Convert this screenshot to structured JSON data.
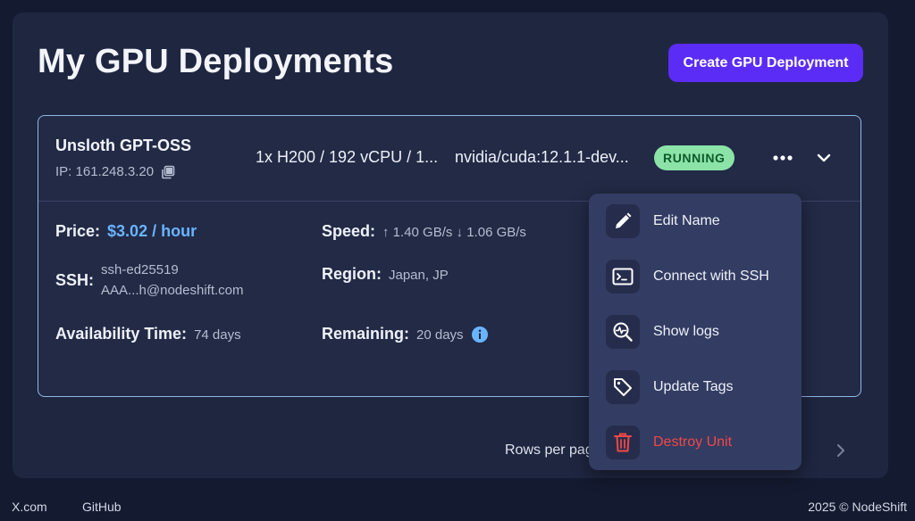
{
  "header": {
    "title": "My GPU Deployments",
    "create_button": "Create GPU Deployment"
  },
  "deployment": {
    "name": "Unsloth GPT-OSS",
    "ip": "IP: 161.248.3.20",
    "spec": "1x H200 / 192 vCPU / 1...",
    "image": "nvidia/cuda:12.1.1-dev...",
    "status": "RUNNING",
    "fields": {
      "price_label": "Price:",
      "price_value": "$3.02 / hour",
      "speed_label": "Speed:",
      "speed_value": "↑ 1.40 GB/s ↓ 1.06 GB/s",
      "ssh_label": "SSH:",
      "ssh_line1": "ssh-ed25519",
      "ssh_line2": "AAA...h@nodeshift.com",
      "region_label": "Region:",
      "region_value": "Japan, JP",
      "availability_label": "Availability Time:",
      "availability_value": "74 days",
      "remaining_label": "Remaining:",
      "remaining_value": "20 days"
    }
  },
  "menu": {
    "items": [
      {
        "label": "Edit Name",
        "icon": "pencil-icon"
      },
      {
        "label": "Connect with SSH",
        "icon": "terminal-icon"
      },
      {
        "label": "Show logs",
        "icon": "logs-search-icon"
      },
      {
        "label": "Update Tags",
        "icon": "tag-icon"
      },
      {
        "label": "Destroy Unit",
        "icon": "trash-icon",
        "danger": true
      }
    ]
  },
  "pagination": {
    "rows_per_page_label": "Rows per pag"
  },
  "footer": {
    "link_x": "X.com",
    "link_github": "GitHub",
    "copyright": "2025 © NodeShift"
  },
  "colors": {
    "accent": "#5b2cf6",
    "price": "#6ab4ff",
    "status_bg": "#8be3a8",
    "danger": "#f04848"
  }
}
